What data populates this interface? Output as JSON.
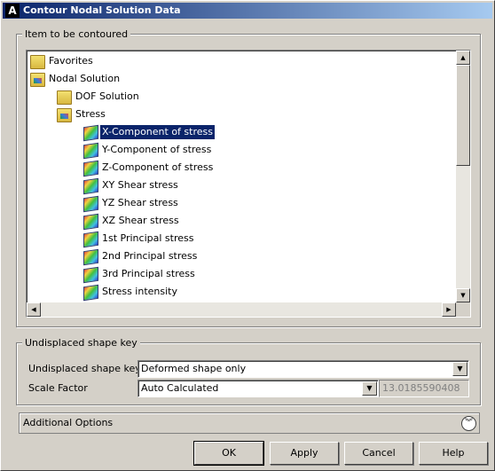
{
  "window": {
    "title": "Contour Nodal Solution Data",
    "logo": "A"
  },
  "item_group": {
    "label": "Item to be contoured"
  },
  "tree": [
    {
      "label": "Favorites",
      "icon": "folder-icon"
    },
    {
      "label": "Nodal Solution",
      "icon": "open-folder-icon"
    },
    {
      "label": "DOF Solution",
      "icon": "folder-icon"
    },
    {
      "label": "Stress",
      "icon": "open-folder-icon"
    },
    {
      "label": "X-Component of stress",
      "icon": "cube-icon",
      "selected": true
    },
    {
      "label": "Y-Component of stress",
      "icon": "cube-icon"
    },
    {
      "label": "Z-Component of stress",
      "icon": "cube-icon"
    },
    {
      "label": "XY Shear stress",
      "icon": "cube-icon"
    },
    {
      "label": "YZ Shear stress",
      "icon": "cube-icon"
    },
    {
      "label": "XZ Shear stress",
      "icon": "cube-icon"
    },
    {
      "label": "1st Principal stress",
      "icon": "cube-icon"
    },
    {
      "label": "2nd Principal stress",
      "icon": "cube-icon"
    },
    {
      "label": "3rd Principal stress",
      "icon": "cube-icon"
    },
    {
      "label": "Stress intensity",
      "icon": "cube-icon"
    }
  ],
  "shape_group": {
    "label": "Undisplaced shape key",
    "shape_key_label": "Undisplaced shape key",
    "shape_key_value": "Deformed shape only",
    "scale_label": "Scale Factor",
    "scale_value": "Auto Calculated",
    "scale_number": "13.0185590408"
  },
  "additional": {
    "label": "Additional Options"
  },
  "buttons": {
    "ok": "OK",
    "apply": "Apply",
    "cancel": "Cancel",
    "help": "Help"
  },
  "colors": {
    "title_start": "#0a246a",
    "title_end": "#a6caf0",
    "selection": "#0a246a",
    "face": "#d4d0c8"
  }
}
